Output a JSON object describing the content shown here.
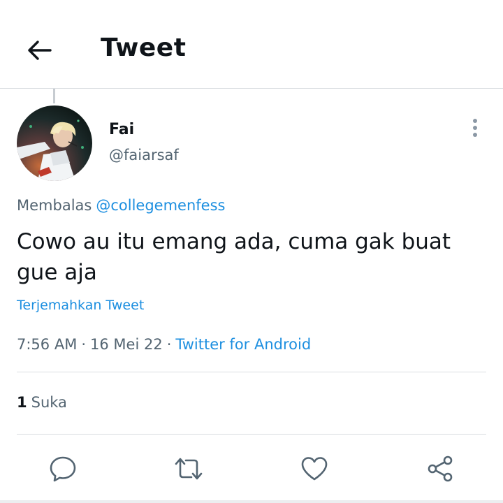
{
  "header": {
    "title": "Tweet",
    "back_icon": "arrow-left-icon"
  },
  "tweet": {
    "author": {
      "display_name": "Fai",
      "handle": "@faiarsaf",
      "avatar_icon": "profile-avatar"
    },
    "reply_label": "Membalas",
    "reply_to": "@collegemenfess",
    "text": "Cowo au itu emang ada, cuma gak buat gue aja",
    "translate_label": "Terjemahkan Tweet",
    "time": "7:56 AM",
    "separator": "·",
    "date": "16 Mei 22",
    "source": "Twitter for Android",
    "likes_count": "1",
    "likes_label": "Suka"
  },
  "actions": {
    "reply_icon": "comment-icon",
    "retweet_icon": "retweet-icon",
    "like_icon": "heart-icon",
    "share_icon": "share-icon"
  },
  "colors": {
    "text_primary": "#0f1419",
    "text_secondary": "#536471",
    "link": "#1d8fe0",
    "divider": "#d9dde1"
  }
}
